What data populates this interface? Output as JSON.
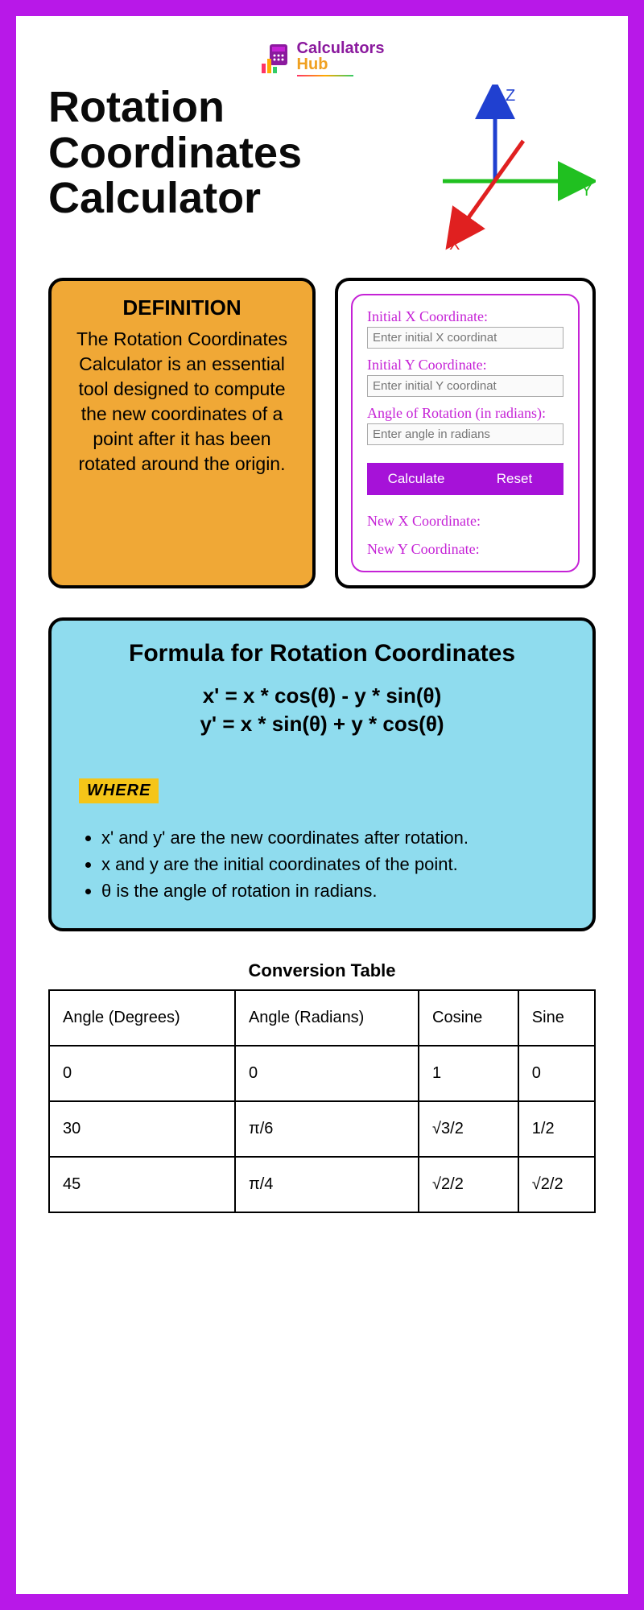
{
  "logo": {
    "line1": "Calculators",
    "line2": "Hub"
  },
  "title": "Rotation Coordinates Calculator",
  "axis": {
    "x": "X",
    "y": "Y",
    "z": "Z"
  },
  "definition": {
    "heading": "DEFINITION",
    "body": "The Rotation Coordinates Calculator is an essential tool designed to compute the new coordinates of a point after it has been rotated around the origin."
  },
  "calc": {
    "labels": {
      "x": "Initial X Coordinate:",
      "y": "Initial Y Coordinate:",
      "angle": "Angle of Rotation (in radians):",
      "newX": "New X Coordinate:",
      "newY": "New Y Coordinate:"
    },
    "placeholders": {
      "x": "Enter initial X coordinat",
      "y": "Enter initial Y coordinat",
      "angle": "Enter angle in radians"
    },
    "buttons": {
      "calculate": "Calculate",
      "reset": "Reset"
    }
  },
  "formula": {
    "heading": "Formula for Rotation Coordinates",
    "eq1": "x' = x * cos(θ) - y * sin(θ)",
    "eq2": "y' = x * sin(θ) + y * cos(θ)",
    "whereLabel": "WHERE",
    "bullets": [
      "x' and y' are the new coordinates after rotation.",
      "x and y are the initial coordinates of the point.",
      "θ is the angle of rotation in radians."
    ]
  },
  "table": {
    "title": "Conversion Table",
    "headers": [
      "Angle (Degrees)",
      "Angle (Radians)",
      "Cosine",
      "Sine"
    ],
    "rows": [
      [
        "0",
        "0",
        "1",
        "0"
      ],
      [
        "30",
        "π/6",
        "√3/2",
        "1/2"
      ],
      [
        "45",
        "π/4",
        "√2/2",
        "√2/2"
      ]
    ]
  }
}
